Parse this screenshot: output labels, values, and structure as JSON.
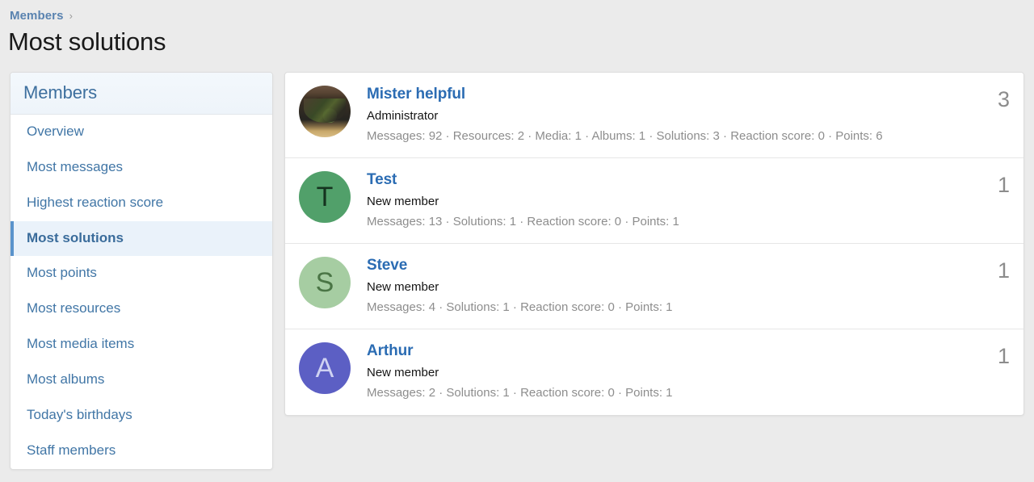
{
  "breadcrumb": {
    "link_label": "Members",
    "separator": "›",
    "separator_icon": "chevron-right-icon"
  },
  "page": {
    "title": "Most solutions",
    "background_color": "#ebebeb"
  },
  "sidebar": {
    "header": "Members",
    "active_item": "Most solutions",
    "accent_color": "#5a93cc",
    "link_color": "#4176a6",
    "items": [
      {
        "label": "Overview",
        "active": false
      },
      {
        "label": "Most messages",
        "active": false
      },
      {
        "label": "Highest reaction score",
        "active": false
      },
      {
        "label": "Most solutions",
        "active": true
      },
      {
        "label": "Most points",
        "active": false
      },
      {
        "label": "Most resources",
        "active": false
      },
      {
        "label": "Most media items",
        "active": false
      },
      {
        "label": "Most albums",
        "active": false
      },
      {
        "label": "Today's birthdays",
        "active": false
      },
      {
        "label": "Staff members",
        "active": false
      }
    ]
  },
  "main": {
    "members": [
      {
        "name": "Mister helpful",
        "user_title": "Administrator",
        "stats": "Messages: 92 · Resources: 2 · Media: 1 · Albums: 1 · Solutions: 3 · Reaction score: 0 · Points: 6",
        "count": "3",
        "avatar": {
          "type": "photo",
          "initial": "",
          "background_color": "#3b3024",
          "text_color": "#ffffff"
        }
      },
      {
        "name": "Test",
        "user_title": "New member",
        "stats": "Messages: 13 · Solutions: 1 · Reaction score: 0 · Points: 1",
        "count": "1",
        "avatar": {
          "type": "initial",
          "initial": "T",
          "background_color": "#51a06a",
          "text_color": "#15331f"
        }
      },
      {
        "name": "Steve",
        "user_title": "New member",
        "stats": "Messages: 4 · Solutions: 1 · Reaction score: 0 · Points: 1",
        "count": "1",
        "avatar": {
          "type": "initial",
          "initial": "S",
          "background_color": "#a6cda2",
          "text_color": "#4a7545"
        }
      },
      {
        "name": "Arthur",
        "user_title": "New member",
        "stats": "Messages: 2 · Solutions: 1 · Reaction score: 0 · Points: 1",
        "count": "1",
        "avatar": {
          "type": "initial",
          "initial": "A",
          "background_color": "#5c5fc4",
          "text_color": "#cfd2f2"
        }
      }
    ]
  }
}
